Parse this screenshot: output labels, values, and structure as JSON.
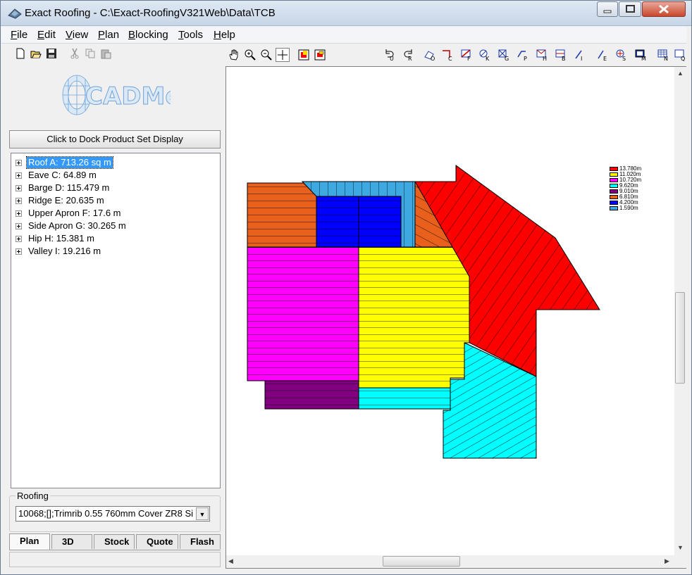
{
  "window": {
    "title": "Exact Roofing  -  C:\\Exact-RoofingV321Web\\Data\\TCB",
    "icon": "exact-roofing-app-icon",
    "controls": [
      "minimize-icon",
      "maximize-icon",
      "close-icon"
    ]
  },
  "menubar": {
    "items": [
      {
        "label": "File",
        "underline": "F"
      },
      {
        "label": "Edit",
        "underline": "E"
      },
      {
        "label": "View",
        "underline": "V"
      },
      {
        "label": "Plan",
        "underline": "P"
      },
      {
        "label": "Blocking",
        "underline": "B"
      },
      {
        "label": "Tools",
        "underline": "T"
      },
      {
        "label": "Help",
        "underline": "H"
      }
    ]
  },
  "left_toolbar": {
    "buttons": [
      "new-icon",
      "open-icon",
      "save-icon",
      "cut-icon",
      "copy-icon",
      "paste-icon"
    ]
  },
  "logo": {
    "text": "CADMethods",
    "icon": "cad-methods-logo"
  },
  "dock_button": {
    "label": "Click to Dock Product Set Display"
  },
  "tree": {
    "items": [
      {
        "label": "Roof A: 713.26 sq m",
        "selected": true
      },
      {
        "label": "Eave C: 64.89 m"
      },
      {
        "label": "Barge D: 115.479 m"
      },
      {
        "label": "Ridge E: 20.635 m"
      },
      {
        "label": "Upper Apron F: 17.6 m"
      },
      {
        "label": "Side Apron G: 30.265 m"
      },
      {
        "label": "Hip H: 15.381 m"
      },
      {
        "label": "Valley I: 19.216 m"
      }
    ]
  },
  "roofing": {
    "group_label": "Roofing",
    "selected": "10068;[];Trimrib 0.55 760mm Cover ZR8 Si"
  },
  "tabs": {
    "items": [
      {
        "label": "Plan",
        "active": true
      },
      {
        "label": "3D"
      },
      {
        "label": "Stock"
      },
      {
        "label": "Quote"
      },
      {
        "label": "Flash"
      }
    ]
  },
  "drawing_toolbar": {
    "buttons": [
      "pan-hand-icon",
      "zoom-in-icon",
      "zoom-out-icon",
      "crosshair-icon",
      "color-fill-icon",
      "fit-view-icon",
      "undo-icon",
      "redo-icon",
      "roof-o-icon",
      "roof-c-icon",
      "roof-f-icon",
      "roof-k-icon",
      "roof-g-icon",
      "roof-p-icon",
      "roof-h-icon",
      "roof-b-icon",
      "roof-i-icon",
      "roof-e-icon",
      "roof-s-icon",
      "roof-m-icon",
      "roof-n-icon",
      "roof-q-icon"
    ]
  },
  "legend": {
    "entries": [
      {
        "label": "13.780m",
        "color": "#ff0000"
      },
      {
        "label": "11.020m",
        "color": "#ffff00"
      },
      {
        "label": "10.720m",
        "color": "#ff00ff"
      },
      {
        "label": "9.620m",
        "color": "#00ffff"
      },
      {
        "label": "9.010m",
        "color": "#800080"
      },
      {
        "label": "6.810m",
        "color": "#e8601c"
      },
      {
        "label": "4.200m",
        "color": "#0000ff"
      },
      {
        "label": "1.590m",
        "color": "#3ea8e0"
      }
    ]
  },
  "colors": {
    "selection": "#3399ff",
    "roof_red": "#ff0000",
    "roof_yellow": "#ffff00",
    "roof_magenta": "#ff00ff",
    "roof_cyan": "#00ffff",
    "roof_purple": "#800080",
    "roof_orange": "#e8601c",
    "roof_blue": "#0000ff",
    "roof_lightblue": "#3ea8e0"
  }
}
